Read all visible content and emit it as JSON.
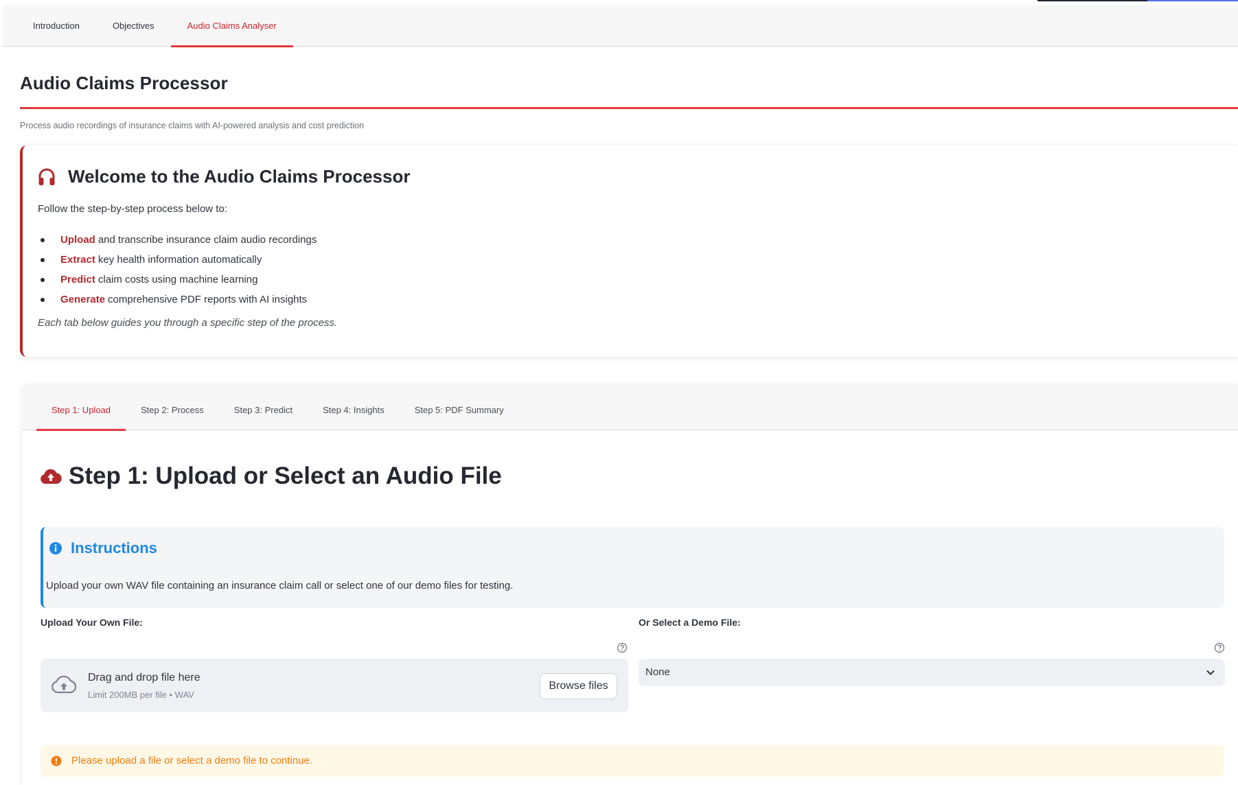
{
  "main_tabs": [
    {
      "label": "Introduction",
      "active": false
    },
    {
      "label": "Objectives",
      "active": false
    },
    {
      "label": "Audio Claims Analyser",
      "active": true
    }
  ],
  "page": {
    "title": "Audio Claims Processor",
    "subtitle": "Process audio recordings of insurance claims with AI-powered analysis and cost prediction"
  },
  "welcome": {
    "icon": "headphones-icon",
    "title": "Welcome to the Audio Claims Processor",
    "intro": "Follow the step-by-step process below to:",
    "items": [
      {
        "keyword": "Upload",
        "text": "and transcribe insurance claim audio recordings"
      },
      {
        "keyword": "Extract",
        "text": "key health information automatically"
      },
      {
        "keyword": "Predict",
        "text": "claim costs using machine learning"
      },
      {
        "keyword": "Generate",
        "text": "comprehensive PDF reports with AI insights"
      }
    ],
    "note": "Each tab below guides you through a specific step of the process."
  },
  "step_tabs": [
    {
      "label": "Step 1: Upload",
      "active": true
    },
    {
      "label": "Step 2: Process",
      "active": false
    },
    {
      "label": "Step 3: Predict",
      "active": false
    },
    {
      "label": "Step 4: Insights",
      "active": false
    },
    {
      "label": "Step 5: PDF Summary",
      "active": false
    }
  ],
  "step1": {
    "icon": "cloud-upload-icon",
    "heading": "Step 1: Upload or Select an Audio File",
    "instructions": {
      "icon": "info-icon",
      "title": "Instructions",
      "text": "Upload your own WAV file containing an insurance claim call or select one of our demo files for testing."
    },
    "upload": {
      "label": "Upload Your Own File:",
      "drop_text": "Drag and drop file here",
      "limit_text": "Limit 200MB per file • WAV",
      "browse_label": "Browse files"
    },
    "demo": {
      "label": "Or Select a Demo File:",
      "selected": "None"
    },
    "warning": "Please upload a file or select a demo file to continue."
  },
  "colors": {
    "accent_red": "#e03a3e",
    "keyword_red": "#b02a2e",
    "info_blue": "#1e88e5",
    "warning_orange": "#f07d11",
    "warning_bg": "#fff8e6"
  }
}
